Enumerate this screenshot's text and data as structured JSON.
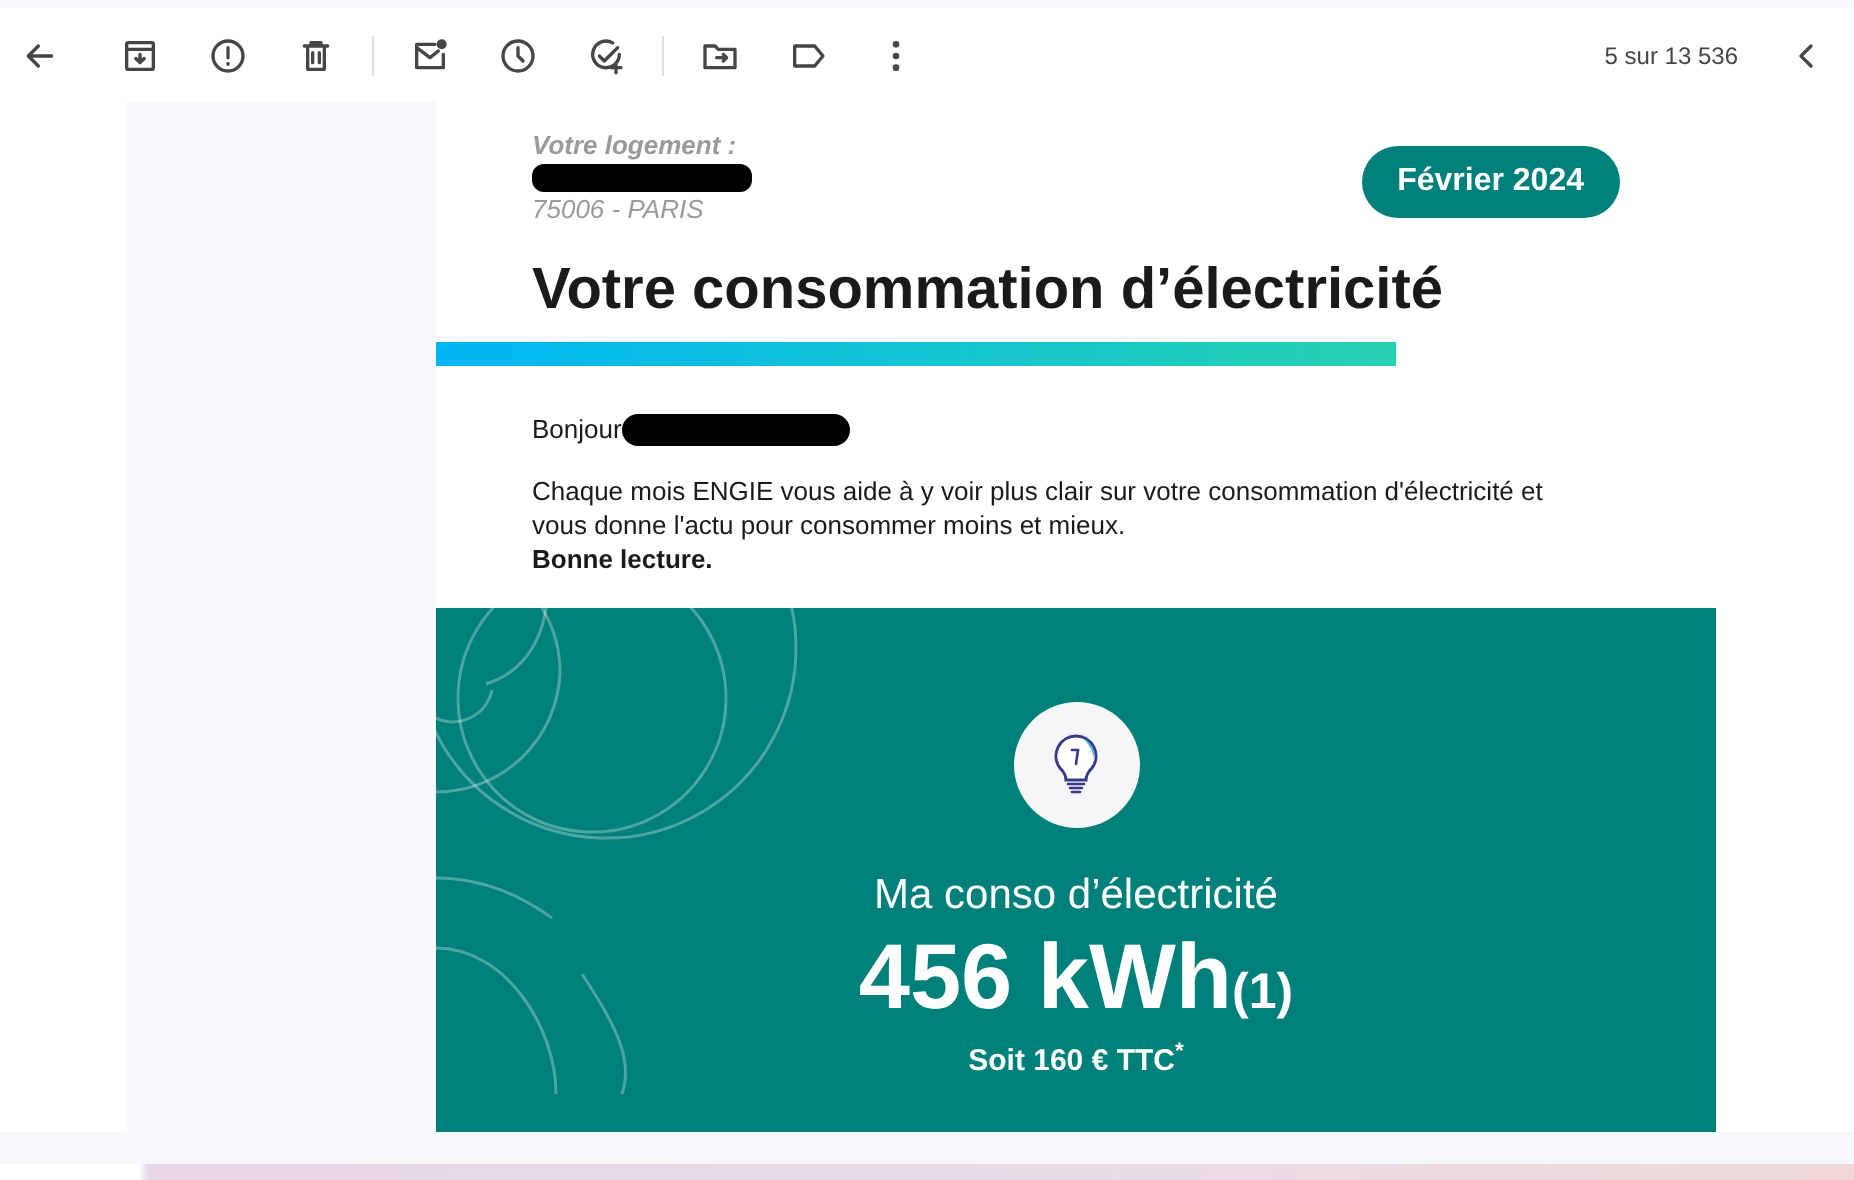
{
  "toolbar": {
    "position": "5 sur 13 536"
  },
  "email": {
    "address_label": "Votre logement :",
    "address_city": "75006 - PARIS",
    "period_badge": "Février 2024",
    "title": "Votre consommation d’électricité",
    "greeting": "Bonjour",
    "intro": "Chaque mois ENGIE vous aide à y voir plus clair sur votre consommation d'électricité et vous donne l'actu pour consommer moins et mieux.",
    "sign_off": "Bonne lecture.",
    "consumption": {
      "label": "Ma conso d’électricité",
      "value": "456 kWh",
      "note": "(1)",
      "cost": "Soit 160 € TTC$^{*}$"
    }
  }
}
